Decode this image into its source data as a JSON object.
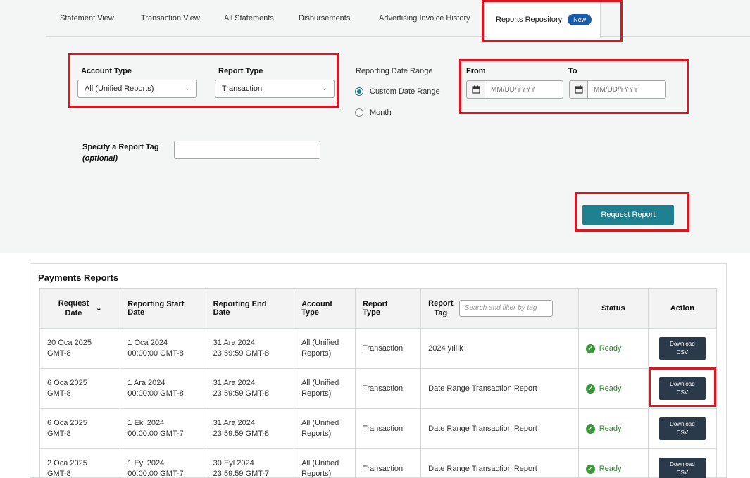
{
  "tabs": [
    {
      "label": "Statement View"
    },
    {
      "label": "Transaction View"
    },
    {
      "label": "All Statements"
    },
    {
      "label": "Disbursements"
    },
    {
      "label": "Advertising Invoice History"
    },
    {
      "label": "Reports Repository",
      "badge": "New",
      "active": true
    }
  ],
  "filters": {
    "account_type_label": "Account Type",
    "account_type_value": "All (Unified Reports)",
    "report_type_label": "Report Type",
    "report_type_value": "Transaction",
    "date_range_label": "Reporting Date Range",
    "custom_range_label": "Custom Date Range",
    "month_label": "Month",
    "from_label": "From",
    "to_label": "To",
    "date_placeholder": "MM/DD/YYYY",
    "tag_label": "Specify a Report Tag",
    "tag_optional": "(optional)",
    "request_button": "Request Report"
  },
  "reports": {
    "title": "Payments Reports",
    "columns": {
      "request_date": [
        "Request",
        "Date"
      ],
      "start_date": [
        "Reporting Start",
        "Date"
      ],
      "end_date": [
        "Reporting End",
        "Date"
      ],
      "account_type": [
        "Account",
        "Type"
      ],
      "report_type": [
        "Report",
        "Type"
      ],
      "tag": [
        "Report",
        "Tag"
      ],
      "tag_search_placeholder": "Search and filter by tag",
      "status": "Status",
      "action": "Action"
    },
    "rows": [
      {
        "request": [
          "20 Oca 2025",
          "GMT-8"
        ],
        "start": [
          "1 Oca 2024",
          "00:00:00 GMT-8"
        ],
        "end": [
          "31 Ara 2024",
          "23:59:59 GMT-8"
        ],
        "account": [
          "All (Unified",
          "Reports)"
        ],
        "type": "Transaction",
        "tag": "2024 yıllık",
        "status": "Ready",
        "action": [
          "Download",
          "CSV"
        ]
      },
      {
        "request": [
          "6 Oca 2025",
          "GMT-8"
        ],
        "start": [
          "1 Ara 2024",
          "00:00:00 GMT-8"
        ],
        "end": [
          "31 Ara 2024",
          "23:59:59 GMT-8"
        ],
        "account": [
          "All (Unified",
          "Reports)"
        ],
        "type": "Transaction",
        "tag": "Date Range Transaction Report",
        "status": "Ready",
        "action": [
          "Download",
          "CSV"
        ]
      },
      {
        "request": [
          "6 Oca 2025",
          "GMT-8"
        ],
        "start": [
          "1 Eki 2024",
          "00:00:00 GMT-7"
        ],
        "end": [
          "31 Ara 2024",
          "23:59:59 GMT-8"
        ],
        "account": [
          "All (Unified",
          "Reports)"
        ],
        "type": "Transaction",
        "tag": "Date Range Transaction Report",
        "status": "Ready",
        "action": [
          "Download",
          "CSV"
        ]
      },
      {
        "request": [
          "2 Oca 2025",
          "GMT-8"
        ],
        "start": [
          "1 Eyl 2024",
          "00:00:00 GMT-7"
        ],
        "end": [
          "30 Eyl 2024",
          "23:59:59 GMT-7"
        ],
        "account": [
          "All (Unified",
          "Reports)"
        ],
        "type": "Transaction",
        "tag": "Date Range Transaction Report",
        "status": "Ready",
        "action": [
          "Download",
          "CSV"
        ]
      }
    ]
  },
  "colors": {
    "highlight": "#e0141e",
    "primary_button": "#1f8090",
    "new_badge": "#1a5aa8",
    "status_ready": "#2d8a2d",
    "download_button": "#2b3a4a"
  }
}
